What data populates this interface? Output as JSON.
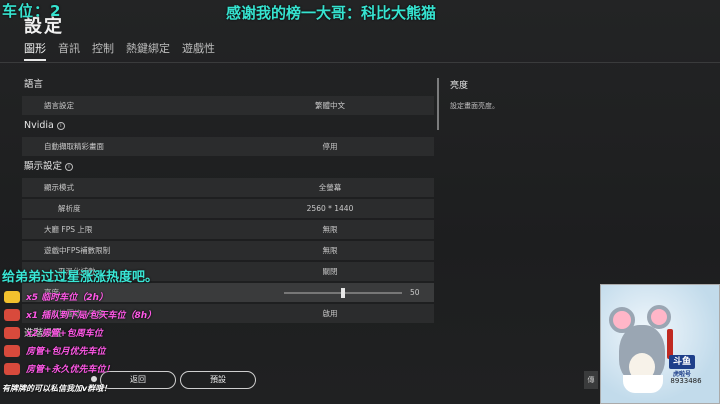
{
  "overlay": {
    "top_left": "车位：2",
    "top_center": "感谢我的榜一大哥：科比大熊猫",
    "chat_line": "给弟弟过过星涨涨热度吧。",
    "bottom_chat": "有牌牌的可以私信我加v群哦！",
    "gifts": [
      {
        "text": "x5 临时车位（2h）",
        "color": "#f2c12e"
      },
      {
        "text": "x1 插队到下局/包天车位（8h）",
        "color": "#d84a3c"
      },
      {
        "text": "x2 房管+包周车位",
        "color": "#d84a3c"
      },
      {
        "text": "房管+包月优先车位",
        "color": "#d84a3c"
      },
      {
        "text": "房管+永久优先车位！",
        "color": "#d84a3c"
      }
    ],
    "webcam_logo": "斗鱼",
    "webcam_logo_sub": "虎啦号",
    "webcam_id": "8933486"
  },
  "header": {
    "title": "設定",
    "tabs": [
      "圖形",
      "音訊",
      "控制",
      "熱鍵綁定",
      "遊戲性"
    ]
  },
  "settings": {
    "language_section": "語言",
    "language_label": "語言設定",
    "language_value": "繁體中文",
    "nvidia_section": "Nvidia",
    "nvidia_label": "自動擷取精彩畫面",
    "nvidia_value": "停用",
    "display_section": "顯示設定",
    "display_mode_label": "顯示模式",
    "display_mode_value": "全螢幕",
    "resolution_label": "解析度",
    "resolution_value": "2560 * 1440",
    "fps_limit_label": "大廳 FPS 上限",
    "fps_limit_value": "無限",
    "ingame_fps_label": "遊戲中FPS補數限制",
    "ingame_fps_value": "無限",
    "smoothing_label": "平滑化補數",
    "smoothing_value": "關閉",
    "brightness_label": "亮度",
    "brightness_value": "50",
    "brightness_level": 50,
    "unify_label": "所有地圖統一亮度",
    "unify_value": "啟用",
    "advanced_section": "進階設置"
  },
  "side_panel": {
    "title": "亮度",
    "desc": "設定畫面亮度。"
  },
  "footer": {
    "back": "返回",
    "default": "預設",
    "edge": "傳"
  }
}
